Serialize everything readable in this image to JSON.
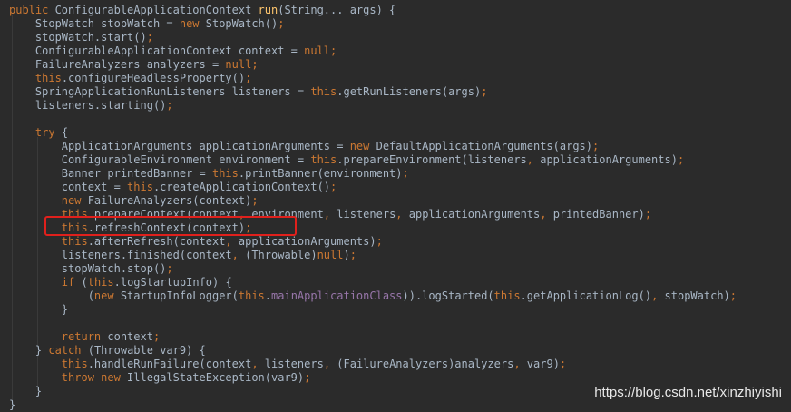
{
  "editor": {
    "background": "#2b2b2b",
    "colors": {
      "plain": "#a9b7c6",
      "keyword": "#cc7832",
      "method": "#ffc66d",
      "field": "#9876aa",
      "highlight_border": "#e0201c"
    },
    "lines": [
      {
        "tokens": [
          {
            "t": "public ",
            "c": "keyword"
          },
          {
            "t": "ConfigurableApplicationContext ",
            "c": "plain"
          },
          {
            "t": "run",
            "c": "method"
          },
          {
            "t": "(String... args) {",
            "c": "plain"
          }
        ]
      },
      {
        "tokens": [
          {
            "t": "    StopWatch stopWatch = ",
            "c": "plain"
          },
          {
            "t": "new ",
            "c": "keyword"
          },
          {
            "t": "StopWatch()",
            "c": "plain"
          },
          {
            "t": ";",
            "c": "keyword"
          }
        ]
      },
      {
        "tokens": [
          {
            "t": "    stopWatch.start()",
            "c": "plain"
          },
          {
            "t": ";",
            "c": "keyword"
          }
        ]
      },
      {
        "tokens": [
          {
            "t": "    ConfigurableApplicationContext context = ",
            "c": "plain"
          },
          {
            "t": "null;",
            "c": "keyword"
          }
        ]
      },
      {
        "tokens": [
          {
            "t": "    FailureAnalyzers analyzers = ",
            "c": "plain"
          },
          {
            "t": "null;",
            "c": "keyword"
          }
        ]
      },
      {
        "tokens": [
          {
            "t": "    ",
            "c": "plain"
          },
          {
            "t": "this",
            "c": "keyword"
          },
          {
            "t": ".configureHeadlessProperty()",
            "c": "plain"
          },
          {
            "t": ";",
            "c": "keyword"
          }
        ]
      },
      {
        "tokens": [
          {
            "t": "    SpringApplicationRunListeners listeners = ",
            "c": "plain"
          },
          {
            "t": "this",
            "c": "keyword"
          },
          {
            "t": ".getRunListeners(args)",
            "c": "plain"
          },
          {
            "t": ";",
            "c": "keyword"
          }
        ]
      },
      {
        "tokens": [
          {
            "t": "    listeners.starting()",
            "c": "plain"
          },
          {
            "t": ";",
            "c": "keyword"
          }
        ]
      },
      {
        "tokens": []
      },
      {
        "tokens": [
          {
            "t": "    ",
            "c": "plain"
          },
          {
            "t": "try ",
            "c": "keyword"
          },
          {
            "t": "{",
            "c": "plain"
          }
        ]
      },
      {
        "tokens": [
          {
            "t": "        ApplicationArguments applicationArguments = ",
            "c": "plain"
          },
          {
            "t": "new ",
            "c": "keyword"
          },
          {
            "t": "DefaultApplicationArguments(args)",
            "c": "plain"
          },
          {
            "t": ";",
            "c": "keyword"
          }
        ]
      },
      {
        "tokens": [
          {
            "t": "        ConfigurableEnvironment environment = ",
            "c": "plain"
          },
          {
            "t": "this",
            "c": "keyword"
          },
          {
            "t": ".prepareEnvironment(listeners",
            "c": "plain"
          },
          {
            "t": ", ",
            "c": "keyword"
          },
          {
            "t": "applicationArguments)",
            "c": "plain"
          },
          {
            "t": ";",
            "c": "keyword"
          }
        ]
      },
      {
        "tokens": [
          {
            "t": "        Banner printedBanner = ",
            "c": "plain"
          },
          {
            "t": "this",
            "c": "keyword"
          },
          {
            "t": ".printBanner(environment)",
            "c": "plain"
          },
          {
            "t": ";",
            "c": "keyword"
          }
        ]
      },
      {
        "tokens": [
          {
            "t": "        context = ",
            "c": "plain"
          },
          {
            "t": "this",
            "c": "keyword"
          },
          {
            "t": ".createApplicationContext()",
            "c": "plain"
          },
          {
            "t": ";",
            "c": "keyword"
          }
        ]
      },
      {
        "tokens": [
          {
            "t": "        ",
            "c": "plain"
          },
          {
            "t": "new ",
            "c": "keyword"
          },
          {
            "t": "FailureAnalyzers(context)",
            "c": "plain"
          },
          {
            "t": ";",
            "c": "keyword"
          }
        ]
      },
      {
        "tokens": [
          {
            "t": "        ",
            "c": "plain"
          },
          {
            "t": "this",
            "c": "keyword"
          },
          {
            "t": ".prepareContext(context",
            "c": "plain"
          },
          {
            "t": ", ",
            "c": "keyword"
          },
          {
            "t": "environment",
            "c": "plain"
          },
          {
            "t": ", ",
            "c": "keyword"
          },
          {
            "t": "listeners",
            "c": "plain"
          },
          {
            "t": ", ",
            "c": "keyword"
          },
          {
            "t": "applicationArguments",
            "c": "plain"
          },
          {
            "t": ", ",
            "c": "keyword"
          },
          {
            "t": "printedBanner)",
            "c": "plain"
          },
          {
            "t": ";",
            "c": "keyword"
          }
        ]
      },
      {
        "tokens": [
          {
            "t": "        ",
            "c": "plain"
          },
          {
            "t": "this",
            "c": "keyword"
          },
          {
            "t": ".refreshContext(context)",
            "c": "plain"
          },
          {
            "t": ";",
            "c": "keyword"
          }
        ]
      },
      {
        "tokens": [
          {
            "t": "        ",
            "c": "plain"
          },
          {
            "t": "this",
            "c": "keyword"
          },
          {
            "t": ".afterRefresh(context",
            "c": "plain"
          },
          {
            "t": ", ",
            "c": "keyword"
          },
          {
            "t": "applicationArguments)",
            "c": "plain"
          },
          {
            "t": ";",
            "c": "keyword"
          }
        ]
      },
      {
        "tokens": [
          {
            "t": "        listeners.finished(context",
            "c": "plain"
          },
          {
            "t": ", ",
            "c": "keyword"
          },
          {
            "t": "(Throwable)",
            "c": "plain"
          },
          {
            "t": "null",
            "c": "keyword"
          },
          {
            "t": ")",
            "c": "plain"
          },
          {
            "t": ";",
            "c": "keyword"
          }
        ]
      },
      {
        "tokens": [
          {
            "t": "        stopWatch.stop()",
            "c": "plain"
          },
          {
            "t": ";",
            "c": "keyword"
          }
        ]
      },
      {
        "tokens": [
          {
            "t": "        ",
            "c": "plain"
          },
          {
            "t": "if ",
            "c": "keyword"
          },
          {
            "t": "(",
            "c": "plain"
          },
          {
            "t": "this",
            "c": "keyword"
          },
          {
            "t": ".logStartupInfo) {",
            "c": "plain"
          }
        ]
      },
      {
        "tokens": [
          {
            "t": "            (",
            "c": "plain"
          },
          {
            "t": "new ",
            "c": "keyword"
          },
          {
            "t": "StartupInfoLogger(",
            "c": "plain"
          },
          {
            "t": "this",
            "c": "keyword"
          },
          {
            "t": ".",
            "c": "plain"
          },
          {
            "t": "mainApplicationClass",
            "c": "field"
          },
          {
            "t": ")).logStarted(",
            "c": "plain"
          },
          {
            "t": "this",
            "c": "keyword"
          },
          {
            "t": ".getApplicationLog()",
            "c": "plain"
          },
          {
            "t": ", ",
            "c": "keyword"
          },
          {
            "t": "stopWatch)",
            "c": "plain"
          },
          {
            "t": ";",
            "c": "keyword"
          }
        ]
      },
      {
        "tokens": [
          {
            "t": "        }",
            "c": "plain"
          }
        ]
      },
      {
        "tokens": []
      },
      {
        "tokens": [
          {
            "t": "        ",
            "c": "plain"
          },
          {
            "t": "return ",
            "c": "keyword"
          },
          {
            "t": "context",
            "c": "plain"
          },
          {
            "t": ";",
            "c": "keyword"
          }
        ]
      },
      {
        "tokens": [
          {
            "t": "    } ",
            "c": "plain"
          },
          {
            "t": "catch ",
            "c": "keyword"
          },
          {
            "t": "(Throwable var9) {",
            "c": "plain"
          }
        ]
      },
      {
        "tokens": [
          {
            "t": "        ",
            "c": "plain"
          },
          {
            "t": "this",
            "c": "keyword"
          },
          {
            "t": ".handleRunFailure(context",
            "c": "plain"
          },
          {
            "t": ", ",
            "c": "keyword"
          },
          {
            "t": "listeners",
            "c": "plain"
          },
          {
            "t": ", ",
            "c": "keyword"
          },
          {
            "t": "(FailureAnalyzers)analyzers",
            "c": "plain"
          },
          {
            "t": ", ",
            "c": "keyword"
          },
          {
            "t": "var9)",
            "c": "plain"
          },
          {
            "t": ";",
            "c": "keyword"
          }
        ]
      },
      {
        "tokens": [
          {
            "t": "        ",
            "c": "plain"
          },
          {
            "t": "throw new ",
            "c": "keyword"
          },
          {
            "t": "IllegalStateException(var9)",
            "c": "plain"
          },
          {
            "t": ";",
            "c": "keyword"
          }
        ]
      },
      {
        "tokens": [
          {
            "t": "    }",
            "c": "plain"
          }
        ]
      },
      {
        "tokens": [
          {
            "t": "}",
            "c": "plain"
          }
        ]
      }
    ]
  },
  "watermark": {
    "text": "https://blog.csdn.net/xinzhiyishi"
  }
}
